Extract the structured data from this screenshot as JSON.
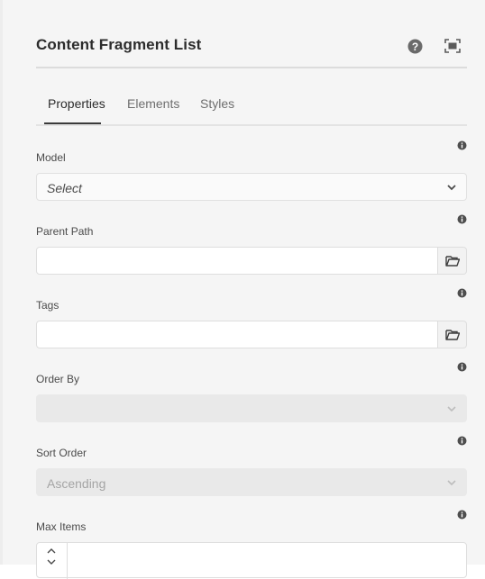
{
  "dialog": {
    "title": "Content Fragment List",
    "icons": {
      "help": "help-icon",
      "fullscreen": "fullscreen-icon"
    }
  },
  "tabs": [
    {
      "label": "Properties",
      "active": true
    },
    {
      "label": "Elements",
      "active": false
    },
    {
      "label": "Styles",
      "active": false
    }
  ],
  "fields": {
    "model": {
      "label": "Model",
      "value": "Select"
    },
    "parent_path": {
      "label": "Parent Path",
      "value": ""
    },
    "tags": {
      "label": "Tags",
      "value": ""
    },
    "order_by": {
      "label": "Order By",
      "value": ""
    },
    "sort_order": {
      "label": "Sort Order",
      "value": "Ascending"
    },
    "max_items": {
      "label": "Max Items",
      "value": ""
    }
  },
  "colors": {
    "panel_bg": "#f5f5f5",
    "active_tab_underline": "#3a3a3a",
    "disabled_field": "#e9e9e9"
  }
}
